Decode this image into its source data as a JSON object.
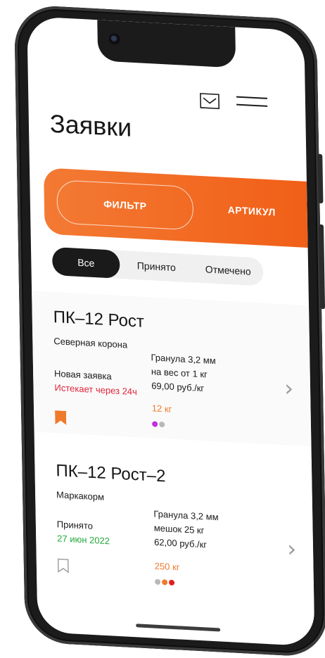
{
  "header": {
    "title": "Заявки"
  },
  "segment": {
    "filter_label": "ФИЛЬТР",
    "article_label": "АРТИКУЛ"
  },
  "status_tabs": {
    "all": "Все",
    "accepted": "Принято",
    "marked": "Отмечено"
  },
  "orders": [
    {
      "title": "ПК–12 Рост",
      "supplier": "Северная корона",
      "status": "Новая заявка",
      "status_sub": "Истекает через 24ч",
      "spec": [
        "Гранула 3,2 мм",
        "на вес от 1 кг",
        "69,00 руб./кг"
      ],
      "weight": "12 кг",
      "dots": [
        "#c32ee0",
        "#b8b8b8"
      ],
      "bookmarked": true
    },
    {
      "title": "ПК–12 Рост–2",
      "supplier": "Маркакорм",
      "status": "Принято",
      "status_sub": "27 июн 2022",
      "spec": [
        "Гранула 3,2 мм",
        "мешок 25 кг",
        "62,00 руб./кг"
      ],
      "weight": "250 кг",
      "dots": [
        "#b8b8b8",
        "#f07a2c",
        "#e01e1e"
      ],
      "bookmarked": false
    }
  ],
  "colors": {
    "accent": "#f1641c",
    "expire_red": "#e0263a",
    "accept_green": "#22a83a"
  },
  "icons": [
    "mail-icon",
    "menu-icon",
    "bookmark-filled-icon",
    "bookmark-outline-icon",
    "chevron-right-icon"
  ]
}
